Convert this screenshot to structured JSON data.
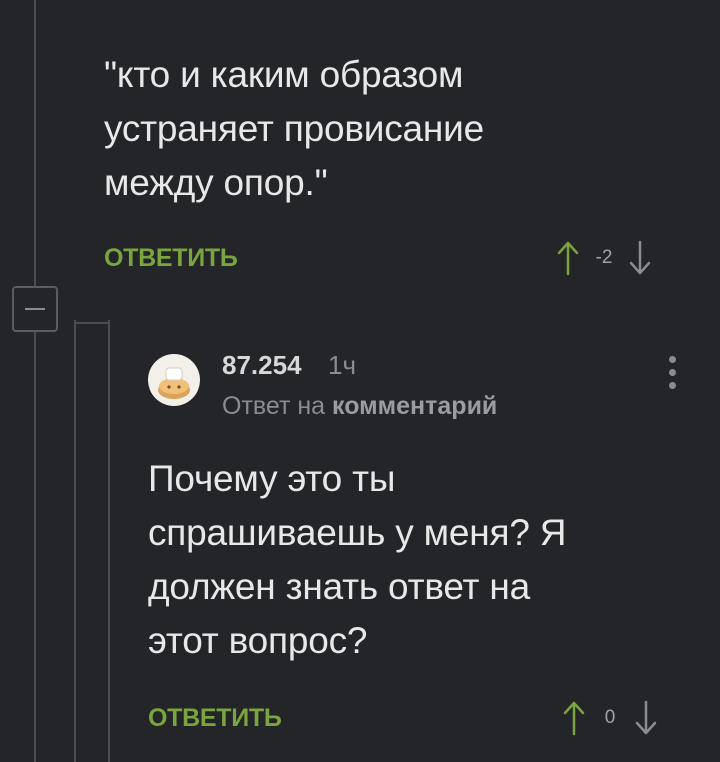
{
  "parent_comment": {
    "lines": [
      "\"кто и каким образом",
      "устраняет провисание",
      "между опор.\""
    ],
    "reply_label": "ОТВЕТИТЬ",
    "score": "-2"
  },
  "reply_comment": {
    "username": "87.254",
    "time": "1ч",
    "reply_prefix": "Ответ на",
    "reply_link": "комментарий",
    "lines": [
      "Почему это ты",
      "спрашиваешь у меня? Я",
      "должен знать ответ на",
      "этот вопрос?"
    ],
    "reply_label": "ОТВЕТИТЬ",
    "score": "0"
  },
  "icons": {
    "collapse": "minus-square-icon",
    "upvote": "arrow-up-icon",
    "downvote": "arrow-down-icon",
    "more": "vertical-dots-icon",
    "avatar": "pie-avatar-icon"
  },
  "colors": {
    "background": "#232529",
    "accent_green": "#7aa43e",
    "muted_text": "#8a8c90",
    "thread_line": "#4a4c50"
  }
}
